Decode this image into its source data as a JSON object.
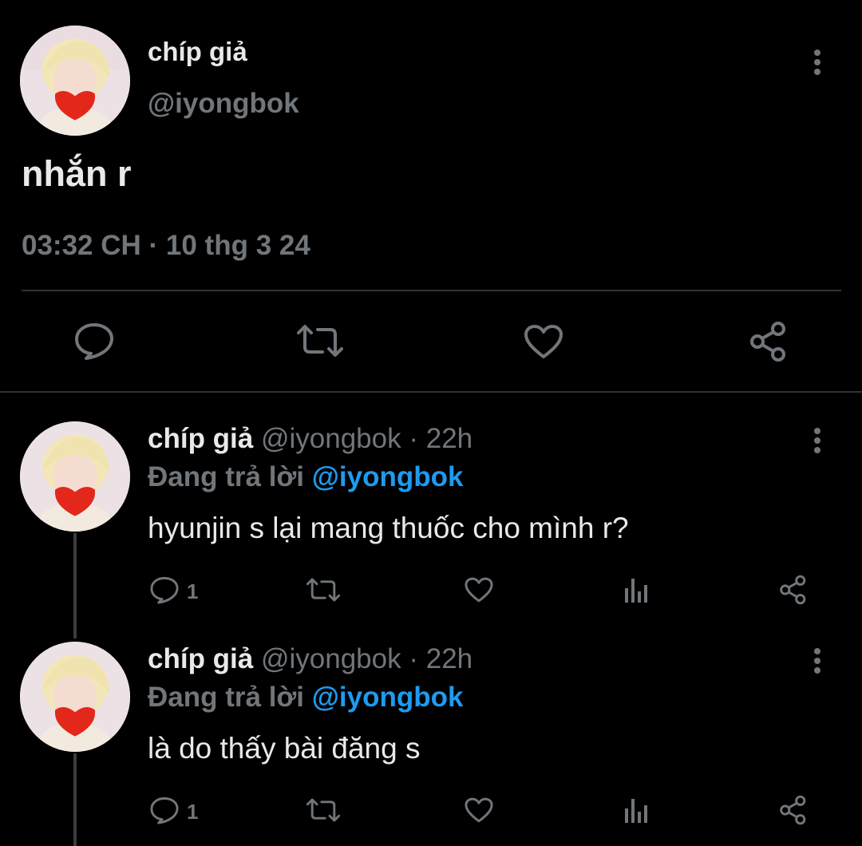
{
  "main_tweet": {
    "display_name": "chíp giả",
    "handle": "@iyongbok",
    "text": "nhắn r",
    "timestamp": "03:32 CH · 10 thg 3 24"
  },
  "replies": [
    {
      "display_name": "chíp giả",
      "handle": "@iyongbok",
      "time": "· 22h",
      "replying_label": "Đang trả lời",
      "replying_to": "@iyongbok",
      "text": "hyunjin s lại mang thuốc cho mình r?",
      "reply_count": "1"
    },
    {
      "display_name": "chíp giả",
      "handle": "@iyongbok",
      "time": "· 22h",
      "replying_label": "Đang trả lời",
      "replying_to": "@iyongbok",
      "text": "là do thấy bài đăng s",
      "reply_count": "1"
    }
  ],
  "colors": {
    "background": "#000000",
    "text": "#e7e9ea",
    "muted": "#71767b",
    "link": "#1d9bf0",
    "divider": "#2f3336"
  },
  "icons": [
    "more-icon",
    "reply-icon",
    "retweet-icon",
    "like-icon",
    "share-icon",
    "views-icon"
  ]
}
